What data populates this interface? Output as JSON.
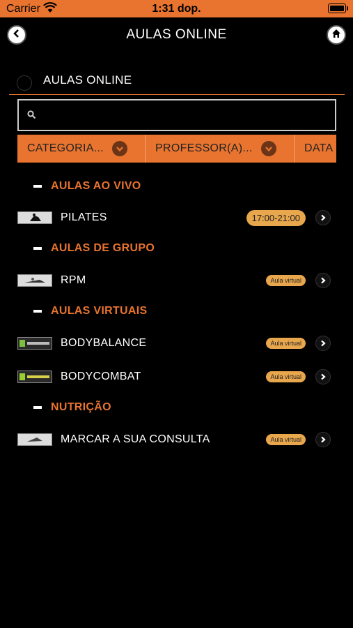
{
  "status_bar": {
    "carrier": "Carrier",
    "time": "1:31 dop."
  },
  "nav": {
    "title": "AULAS ONLINE"
  },
  "section": {
    "label": "AULAS ONLINE"
  },
  "search": {
    "placeholder": ""
  },
  "filters": [
    "CATEGORIA...",
    "PROFESSOR(A)...",
    "DATA"
  ],
  "groups": [
    {
      "title": "AULAS AO VIVO",
      "items": [
        {
          "name": "PILATES",
          "badge": "17:00-21:00"
        }
      ]
    },
    {
      "title": "AULAS DE GRUPO",
      "items": [
        {
          "name": "RPM",
          "badge": "Aula virtual"
        }
      ]
    },
    {
      "title": "AULAS VIRTUAIS",
      "items": [
        {
          "name": "BODYBALANCE",
          "badge": "Aula virtual"
        },
        {
          "name": "BODYCOMBAT",
          "badge": "Aula virtual"
        }
      ]
    },
    {
      "title": "NUTRIÇÃO",
      "items": [
        {
          "name": "MARCAR A SUA CONSULTA",
          "badge": "Aula virtual"
        }
      ]
    }
  ],
  "colors": {
    "accent": "#e8742f",
    "badge": "#e8a64d"
  },
  "icons": {
    "back": "chevron-left-icon",
    "home": "home-icon",
    "search": "search-icon",
    "row": "chevron-right-icon"
  }
}
